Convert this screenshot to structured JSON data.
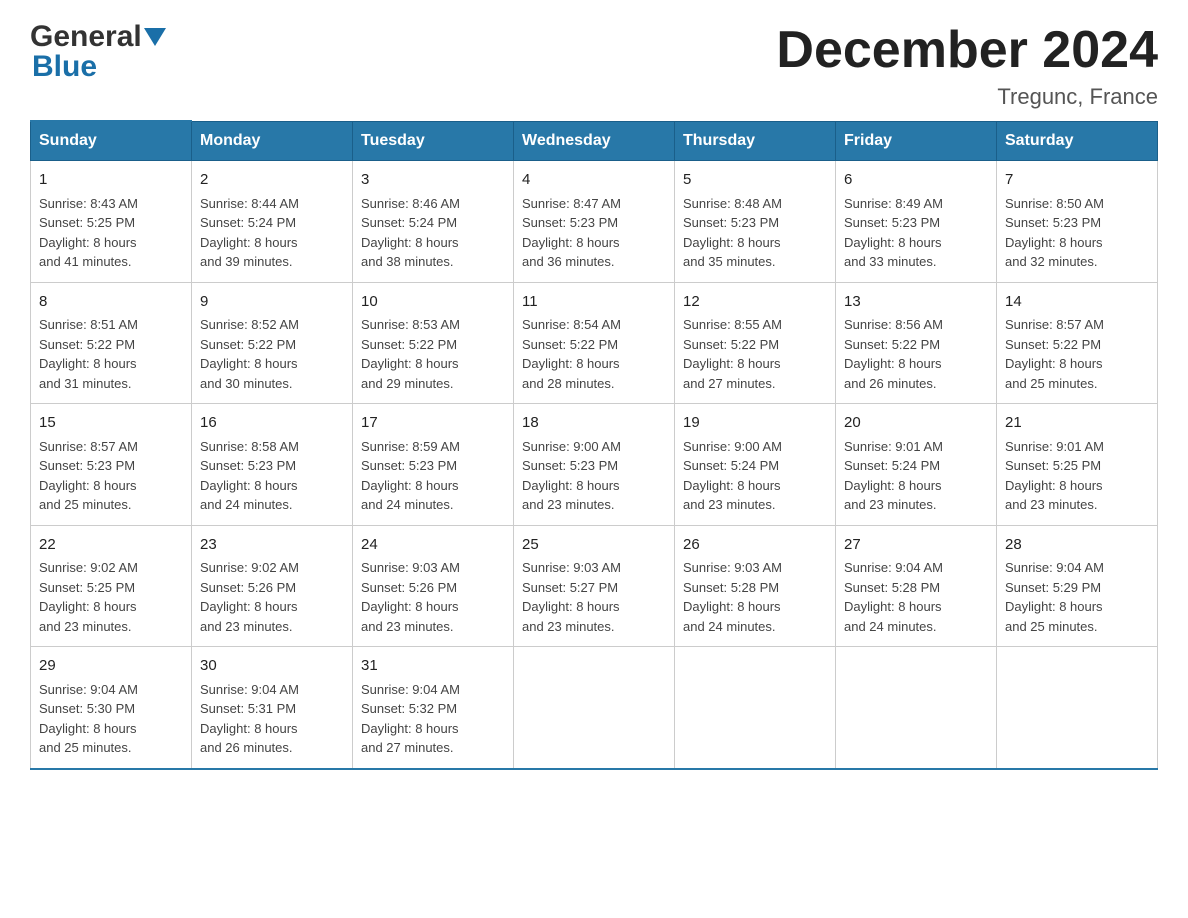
{
  "logo": {
    "general": "General",
    "blue": "Blue",
    "arrow": "▶"
  },
  "title": "December 2024",
  "subtitle": "Tregunc, France",
  "days_of_week": [
    "Sunday",
    "Monday",
    "Tuesday",
    "Wednesday",
    "Thursday",
    "Friday",
    "Saturday"
  ],
  "weeks": [
    [
      {
        "day": "1",
        "sunrise": "Sunrise: 8:43 AM",
        "sunset": "Sunset: 5:25 PM",
        "daylight": "Daylight: 8 hours",
        "daylight2": "and 41 minutes."
      },
      {
        "day": "2",
        "sunrise": "Sunrise: 8:44 AM",
        "sunset": "Sunset: 5:24 PM",
        "daylight": "Daylight: 8 hours",
        "daylight2": "and 39 minutes."
      },
      {
        "day": "3",
        "sunrise": "Sunrise: 8:46 AM",
        "sunset": "Sunset: 5:24 PM",
        "daylight": "Daylight: 8 hours",
        "daylight2": "and 38 minutes."
      },
      {
        "day": "4",
        "sunrise": "Sunrise: 8:47 AM",
        "sunset": "Sunset: 5:23 PM",
        "daylight": "Daylight: 8 hours",
        "daylight2": "and 36 minutes."
      },
      {
        "day": "5",
        "sunrise": "Sunrise: 8:48 AM",
        "sunset": "Sunset: 5:23 PM",
        "daylight": "Daylight: 8 hours",
        "daylight2": "and 35 minutes."
      },
      {
        "day": "6",
        "sunrise": "Sunrise: 8:49 AM",
        "sunset": "Sunset: 5:23 PM",
        "daylight": "Daylight: 8 hours",
        "daylight2": "and 33 minutes."
      },
      {
        "day": "7",
        "sunrise": "Sunrise: 8:50 AM",
        "sunset": "Sunset: 5:23 PM",
        "daylight": "Daylight: 8 hours",
        "daylight2": "and 32 minutes."
      }
    ],
    [
      {
        "day": "8",
        "sunrise": "Sunrise: 8:51 AM",
        "sunset": "Sunset: 5:22 PM",
        "daylight": "Daylight: 8 hours",
        "daylight2": "and 31 minutes."
      },
      {
        "day": "9",
        "sunrise": "Sunrise: 8:52 AM",
        "sunset": "Sunset: 5:22 PM",
        "daylight": "Daylight: 8 hours",
        "daylight2": "and 30 minutes."
      },
      {
        "day": "10",
        "sunrise": "Sunrise: 8:53 AM",
        "sunset": "Sunset: 5:22 PM",
        "daylight": "Daylight: 8 hours",
        "daylight2": "and 29 minutes."
      },
      {
        "day": "11",
        "sunrise": "Sunrise: 8:54 AM",
        "sunset": "Sunset: 5:22 PM",
        "daylight": "Daylight: 8 hours",
        "daylight2": "and 28 minutes."
      },
      {
        "day": "12",
        "sunrise": "Sunrise: 8:55 AM",
        "sunset": "Sunset: 5:22 PM",
        "daylight": "Daylight: 8 hours",
        "daylight2": "and 27 minutes."
      },
      {
        "day": "13",
        "sunrise": "Sunrise: 8:56 AM",
        "sunset": "Sunset: 5:22 PM",
        "daylight": "Daylight: 8 hours",
        "daylight2": "and 26 minutes."
      },
      {
        "day": "14",
        "sunrise": "Sunrise: 8:57 AM",
        "sunset": "Sunset: 5:22 PM",
        "daylight": "Daylight: 8 hours",
        "daylight2": "and 25 minutes."
      }
    ],
    [
      {
        "day": "15",
        "sunrise": "Sunrise: 8:57 AM",
        "sunset": "Sunset: 5:23 PM",
        "daylight": "Daylight: 8 hours",
        "daylight2": "and 25 minutes."
      },
      {
        "day": "16",
        "sunrise": "Sunrise: 8:58 AM",
        "sunset": "Sunset: 5:23 PM",
        "daylight": "Daylight: 8 hours",
        "daylight2": "and 24 minutes."
      },
      {
        "day": "17",
        "sunrise": "Sunrise: 8:59 AM",
        "sunset": "Sunset: 5:23 PM",
        "daylight": "Daylight: 8 hours",
        "daylight2": "and 24 minutes."
      },
      {
        "day": "18",
        "sunrise": "Sunrise: 9:00 AM",
        "sunset": "Sunset: 5:23 PM",
        "daylight": "Daylight: 8 hours",
        "daylight2": "and 23 minutes."
      },
      {
        "day": "19",
        "sunrise": "Sunrise: 9:00 AM",
        "sunset": "Sunset: 5:24 PM",
        "daylight": "Daylight: 8 hours",
        "daylight2": "and 23 minutes."
      },
      {
        "day": "20",
        "sunrise": "Sunrise: 9:01 AM",
        "sunset": "Sunset: 5:24 PM",
        "daylight": "Daylight: 8 hours",
        "daylight2": "and 23 minutes."
      },
      {
        "day": "21",
        "sunrise": "Sunrise: 9:01 AM",
        "sunset": "Sunset: 5:25 PM",
        "daylight": "Daylight: 8 hours",
        "daylight2": "and 23 minutes."
      }
    ],
    [
      {
        "day": "22",
        "sunrise": "Sunrise: 9:02 AM",
        "sunset": "Sunset: 5:25 PM",
        "daylight": "Daylight: 8 hours",
        "daylight2": "and 23 minutes."
      },
      {
        "day": "23",
        "sunrise": "Sunrise: 9:02 AM",
        "sunset": "Sunset: 5:26 PM",
        "daylight": "Daylight: 8 hours",
        "daylight2": "and 23 minutes."
      },
      {
        "day": "24",
        "sunrise": "Sunrise: 9:03 AM",
        "sunset": "Sunset: 5:26 PM",
        "daylight": "Daylight: 8 hours",
        "daylight2": "and 23 minutes."
      },
      {
        "day": "25",
        "sunrise": "Sunrise: 9:03 AM",
        "sunset": "Sunset: 5:27 PM",
        "daylight": "Daylight: 8 hours",
        "daylight2": "and 23 minutes."
      },
      {
        "day": "26",
        "sunrise": "Sunrise: 9:03 AM",
        "sunset": "Sunset: 5:28 PM",
        "daylight": "Daylight: 8 hours",
        "daylight2": "and 24 minutes."
      },
      {
        "day": "27",
        "sunrise": "Sunrise: 9:04 AM",
        "sunset": "Sunset: 5:28 PM",
        "daylight": "Daylight: 8 hours",
        "daylight2": "and 24 minutes."
      },
      {
        "day": "28",
        "sunrise": "Sunrise: 9:04 AM",
        "sunset": "Sunset: 5:29 PM",
        "daylight": "Daylight: 8 hours",
        "daylight2": "and 25 minutes."
      }
    ],
    [
      {
        "day": "29",
        "sunrise": "Sunrise: 9:04 AM",
        "sunset": "Sunset: 5:30 PM",
        "daylight": "Daylight: 8 hours",
        "daylight2": "and 25 minutes."
      },
      {
        "day": "30",
        "sunrise": "Sunrise: 9:04 AM",
        "sunset": "Sunset: 5:31 PM",
        "daylight": "Daylight: 8 hours",
        "daylight2": "and 26 minutes."
      },
      {
        "day": "31",
        "sunrise": "Sunrise: 9:04 AM",
        "sunset": "Sunset: 5:32 PM",
        "daylight": "Daylight: 8 hours",
        "daylight2": "and 27 minutes."
      },
      {
        "day": "",
        "sunrise": "",
        "sunset": "",
        "daylight": "",
        "daylight2": ""
      },
      {
        "day": "",
        "sunrise": "",
        "sunset": "",
        "daylight": "",
        "daylight2": ""
      },
      {
        "day": "",
        "sunrise": "",
        "sunset": "",
        "daylight": "",
        "daylight2": ""
      },
      {
        "day": "",
        "sunrise": "",
        "sunset": "",
        "daylight": "",
        "daylight2": ""
      }
    ]
  ]
}
